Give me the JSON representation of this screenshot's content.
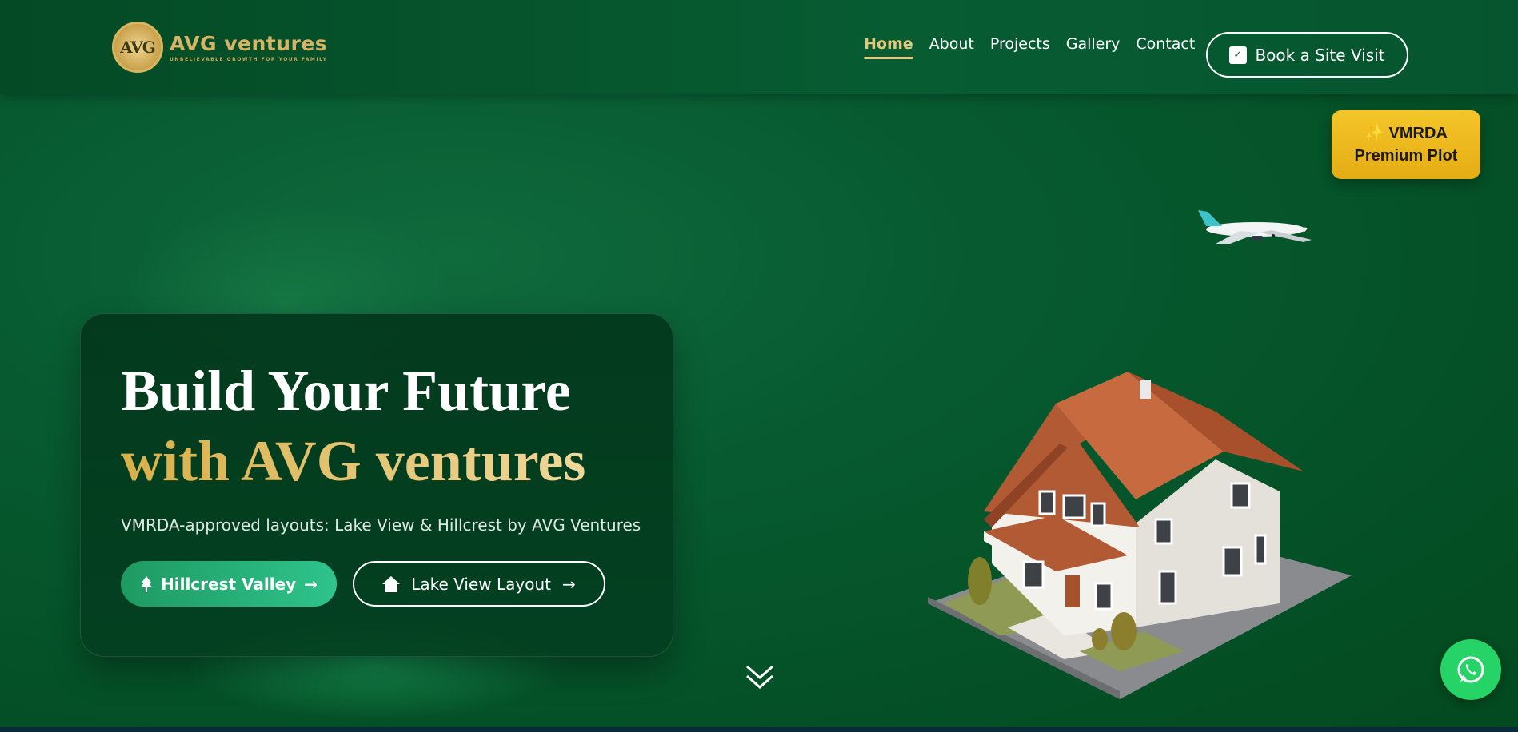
{
  "header": {
    "logo": {
      "emblem_text": "AVG",
      "brand": "AVG ventures",
      "tagline": "UNBELIEVABLE GROWTH FOR YOUR FAMILY"
    },
    "nav": [
      {
        "label": "Home",
        "active": true
      },
      {
        "label": "About"
      },
      {
        "label": "Projects"
      },
      {
        "label": "Gallery"
      },
      {
        "label": "Contact"
      }
    ],
    "book_button": {
      "label": "Book a Site Visit",
      "icon": "calendar-check-icon"
    }
  },
  "badge": {
    "line1": "✨ VMRDA",
    "line2": "Premium Plot"
  },
  "hero": {
    "title_line1": "Build Your Future",
    "title_line2": "with AVG ventures",
    "subtitle": "VMRDA-approved layouts: Lake View & Hillcrest by AVG Ventures",
    "primary_button": {
      "label": "Hillcrest Valley",
      "icon": "tree-icon"
    },
    "secondary_button": {
      "label": "Lake View Layout",
      "icon": "home-icon"
    }
  },
  "colors": {
    "primary_green": "#075a30",
    "gold": "#e5c77d",
    "badge_yellow": "#f4c62a",
    "whatsapp": "#25d366"
  }
}
